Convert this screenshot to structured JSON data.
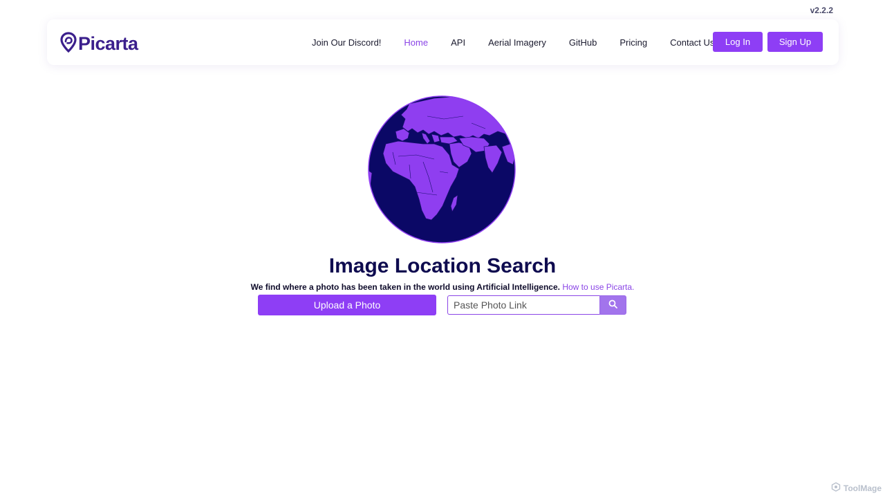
{
  "version": "v2.2.2",
  "brand": {
    "name": "Picarta"
  },
  "nav": {
    "links": [
      {
        "label": "Join Our Discord!"
      },
      {
        "label": "Home",
        "active": true
      },
      {
        "label": "API"
      },
      {
        "label": "Aerial Imagery"
      },
      {
        "label": "GitHub"
      },
      {
        "label": "Pricing"
      },
      {
        "label": "Contact Us"
      }
    ],
    "login_label": "Log In",
    "signup_label": "Sign Up"
  },
  "hero": {
    "title": "Image Location Search",
    "subtitle": "We find where a photo has been taken in the world using Artificial Intelligence.",
    "howto_label": "How to use Picarta.",
    "upload_label": "Upload a Photo",
    "link_placeholder": "Paste Photo Link"
  },
  "watermark": {
    "text": "ToolMage"
  },
  "colors": {
    "accent": "#8e3ef5",
    "accent_light": "#a274ec",
    "navy": "#0e0b4f",
    "globe_ocean": "#0b0866",
    "globe_land": "#8f3ef0"
  },
  "icons": {
    "brand": "map-pin-icon",
    "search": "search-icon",
    "watermark": "toolmage-logo-icon"
  }
}
